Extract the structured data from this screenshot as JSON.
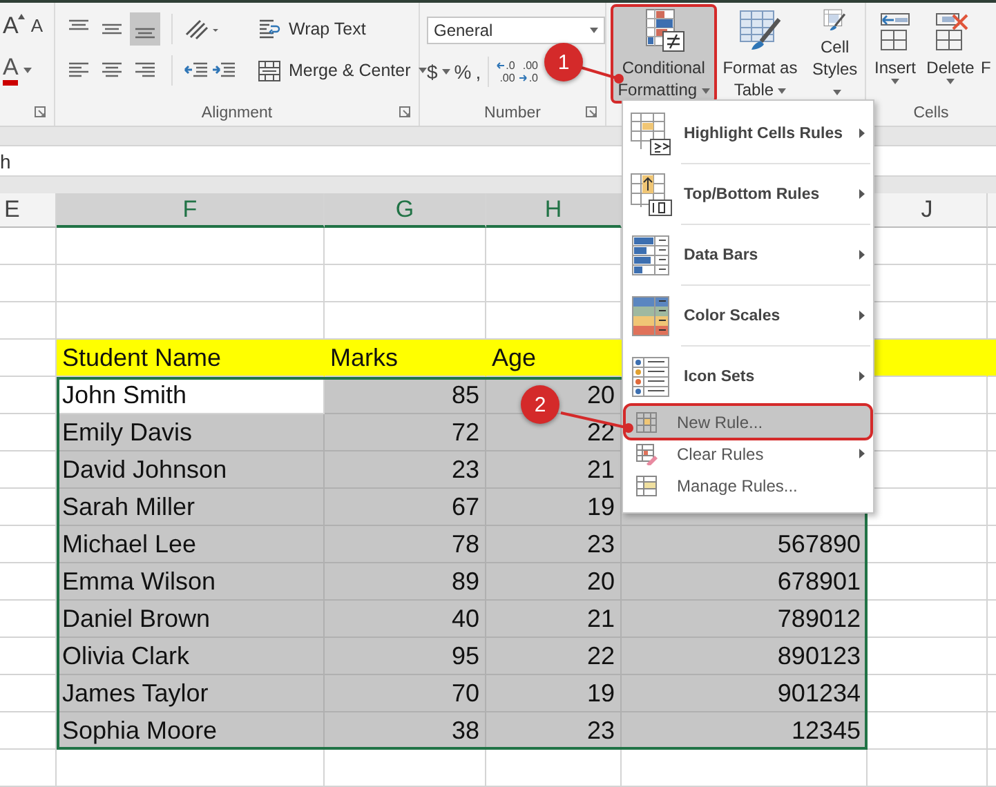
{
  "ribbon": {
    "font_group": {
      "grow_icon": "A",
      "shrink_icon": "A",
      "color_icon": "A"
    },
    "alignment": {
      "label": "Alignment",
      "top_buttons": [
        {
          "kind": "top",
          "selected": false
        },
        {
          "kind": "middle",
          "selected": false
        },
        {
          "kind": "bottom",
          "selected": true
        }
      ],
      "bottom_buttons": [
        {
          "kind": "left",
          "selected": false
        },
        {
          "kind": "center",
          "selected": false
        },
        {
          "kind": "right",
          "selected": false
        }
      ],
      "wrap_text": "Wrap Text",
      "merge_center": "Merge & Center"
    },
    "number": {
      "label": "Number",
      "format": "General",
      "symbols": [
        "$",
        "%",
        ","
      ],
      "decimals": [
        {
          "kind": "increase",
          "top": ".0",
          "bottom": ".00"
        },
        {
          "kind": "decrease",
          "top": ".00",
          "bottom": ".0"
        }
      ]
    },
    "styles": [
      {
        "kind": "conditional",
        "label": "Conditional Formatting",
        "selected": true,
        "outlined": true
      },
      {
        "kind": "table",
        "label": "Format as Table",
        "selected": false,
        "outlined": false
      },
      {
        "kind": "cell",
        "label": "Cell Styles",
        "selected": false,
        "outlined": false
      }
    ],
    "cells": {
      "label": "Cells",
      "buttons": [
        {
          "kind": "insert",
          "label": "Insert"
        },
        {
          "kind": "delete",
          "label": "Delete"
        },
        {
          "kind": "format",
          "label": "F"
        }
      ]
    }
  },
  "formula_bar": {
    "value": "h"
  },
  "sheet": {
    "columns": [
      {
        "name": "E",
        "selected": false
      },
      {
        "name": "F",
        "selected": true
      },
      {
        "name": "G",
        "selected": true
      },
      {
        "name": "H",
        "selected": true
      },
      {
        "name": "J",
        "selected": false
      }
    ],
    "header_row": [
      "Student Name",
      "Marks",
      "Age"
    ],
    "rows": [
      {
        "name": "John Smith",
        "marks": "85",
        "age": "20",
        "selected": true,
        "active": true
      },
      {
        "name": "Emily Davis",
        "marks": "72",
        "age": "22",
        "selected": true,
        "active": false
      },
      {
        "name": "David Johnson",
        "marks": "23",
        "age": "21",
        "selected": true,
        "active": false
      },
      {
        "name": "Sarah Miller",
        "marks": "67",
        "age": "19",
        "selected": true,
        "active": false
      },
      {
        "name": "Michael Lee",
        "marks": "78",
        "age": "23",
        "column_4": "567890",
        "selected": true,
        "active": false
      },
      {
        "name": "Emma Wilson",
        "marks": "89",
        "age": "20",
        "column_4": "678901",
        "selected": true,
        "active": false
      },
      {
        "name": "Daniel Brown",
        "marks": "40",
        "age": "21",
        "column_4": "789012",
        "selected": true,
        "active": false
      },
      {
        "name": "Olivia Clark",
        "marks": "95",
        "age": "22",
        "column_4": "890123",
        "selected": true,
        "active": false
      },
      {
        "name": "James Taylor",
        "marks": "70",
        "age": "19",
        "column_4": "901234",
        "selected": true,
        "active": false
      },
      {
        "name": "Sophia Moore",
        "marks": "38",
        "age": "23",
        "column_4": "12345",
        "selected": true,
        "active": false
      }
    ]
  },
  "menu": {
    "items": [
      {
        "kind": "highlight",
        "label": "Highlight Cells Rules",
        "submenu": true,
        "selected": false,
        "outlined": false
      },
      {
        "kind": "topbottom",
        "label": "Top/Bottom Rules",
        "submenu": true,
        "selected": false,
        "outlined": false
      },
      {
        "kind": "databars",
        "label": "Data Bars",
        "submenu": true,
        "selected": false,
        "outlined": false
      },
      {
        "kind": "colorscales",
        "label": "Color Scales",
        "submenu": true,
        "selected": false,
        "outlined": false
      },
      {
        "kind": "iconsets",
        "label": "Icon Sets",
        "submenu": true,
        "selected": false,
        "outlined": false
      },
      {
        "kind": "newrule",
        "label": "New Rule...",
        "submenu": false,
        "selected": true,
        "outlined": true
      },
      {
        "kind": "clearrules",
        "label": "Clear Rules",
        "submenu": true,
        "selected": false,
        "outlined": false
      },
      {
        "kind": "managerules",
        "label": "Manage Rules...",
        "submenu": false,
        "selected": false,
        "outlined": false
      }
    ]
  },
  "callouts": [
    {
      "number": "1"
    },
    {
      "number": "2"
    }
  ]
}
